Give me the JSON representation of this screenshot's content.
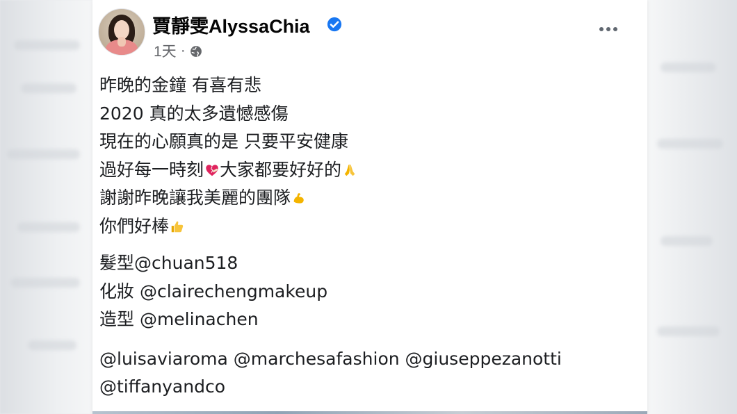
{
  "post": {
    "author": "賈靜雯AlyssaChia",
    "time": "1天",
    "separator": "·",
    "lines": [
      {
        "text": "昨晚的金鐘 有喜有悲",
        "emoji": ""
      },
      {
        "text": "2020 真的太多遺憾感傷",
        "emoji": ""
      },
      {
        "text": "現在的心願真的是 只要平安健康",
        "emoji": ""
      },
      {
        "text": "過好每一時刻",
        "emoji": "heart-mending-emoji",
        "text_after": "大家都要好好的",
        "emoji2": "pray-emoji"
      },
      {
        "text": "謝謝昨晚讓我美麗的團隊",
        "emoji": "muscle-emoji"
      },
      {
        "text": "你們好棒",
        "emoji": "thumbs-up-emoji"
      }
    ],
    "credits": [
      {
        "label": "髮型",
        "handle": "@chuan518"
      },
      {
        "label": "化妝 ",
        "handle": "@clairechengmakeup"
      },
      {
        "label": "造型 ",
        "handle": "@melinachen"
      }
    ],
    "brand_line_1": "@luisaviaroma @marchesafashion @giuseppezanotti",
    "brand_line_2": "@tiffanyandco"
  },
  "icons": {
    "verified": "verified-badge-icon",
    "privacy": "globe-icon",
    "menu": "more-options-icon"
  },
  "colors": {
    "verified_blue": "#1877f2",
    "text": "#1c1e21",
    "meta": "#65676b",
    "background": "#e9ebee"
  }
}
